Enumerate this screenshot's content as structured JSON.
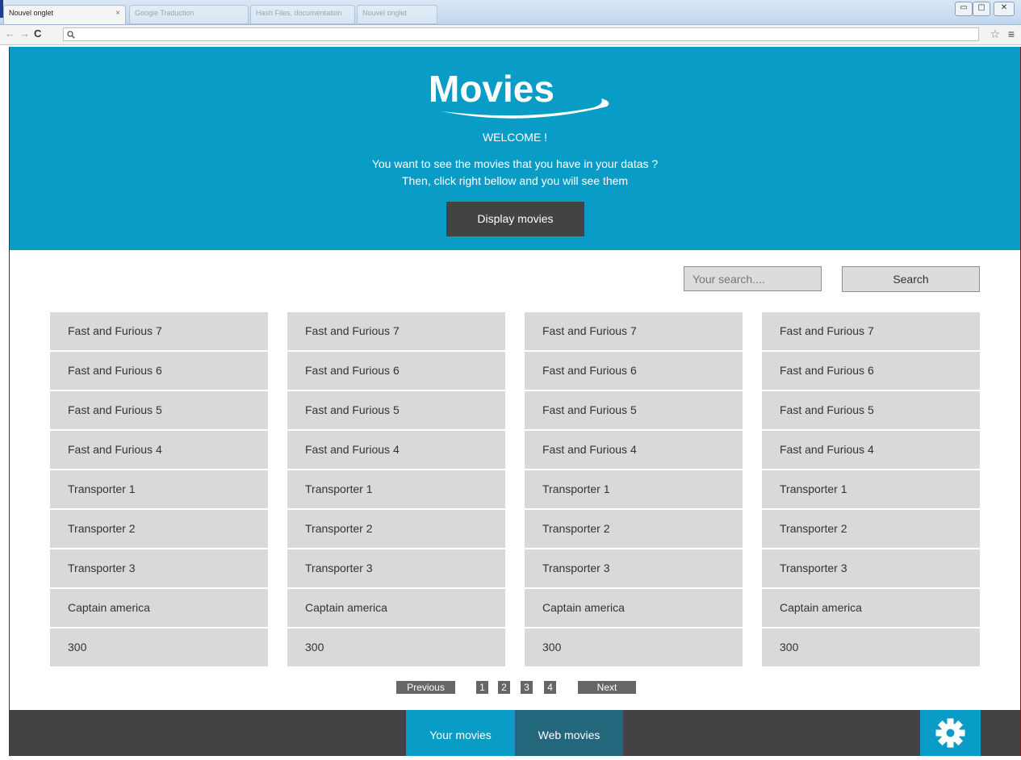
{
  "browser": {
    "active_tab": "Nouvel onglet",
    "tab_close": "×",
    "other_tabs": [
      "Google Traduction",
      "Hash Files, documentation",
      "Nouvel onglet"
    ],
    "window_controls": [
      "▭",
      "▢",
      "✕"
    ]
  },
  "addressbar": {
    "back": "←",
    "forward": "→",
    "reload": "C",
    "url": "",
    "star": "☆",
    "menu": "≡"
  },
  "hero": {
    "logo_text": "Movies",
    "welcome": "WELCOME !",
    "intro_line1": "You want to see the movies that you have in your datas ?",
    "intro_line2": "Then, click right bellow and you will see them",
    "display_button": "Display movies"
  },
  "search": {
    "placeholder": "Your search....",
    "button": "Search"
  },
  "movies": {
    "columns": [
      [
        "Fast and Furious 7",
        "Fast and Furious 6",
        "Fast and Furious 5",
        "Fast and Furious 4",
        "Transporter 1",
        "Transporter 2",
        "Transporter 3",
        "Captain america",
        "300"
      ],
      [
        "Fast and Furious 7",
        "Fast and Furious 6",
        "Fast and Furious 5",
        "Fast and Furious 4",
        "Transporter 1",
        "Transporter 2",
        "Transporter 3",
        "Captain america",
        "300"
      ],
      [
        "Fast and Furious 7",
        "Fast and Furious 6",
        "Fast and Furious 5",
        "Fast and Furious 4",
        "Transporter 1",
        "Transporter 2",
        "Transporter 3",
        "Captain america",
        "300"
      ],
      [
        "Fast and Furious 7",
        "Fast and Furious 6",
        "Fast and Furious 5",
        "Fast and Furious 4",
        "Transporter 1",
        "Transporter 2",
        "Transporter 3",
        "Captain america",
        "300"
      ]
    ]
  },
  "pagination": {
    "previous": "Previous",
    "pages": [
      "1",
      "2",
      "3",
      "4"
    ],
    "next": "Next"
  },
  "footer": {
    "tab_active": "Your movies",
    "tab_other": "Web movies",
    "settings_icon": "gear-icon"
  },
  "colors": {
    "accent": "#099cc6",
    "dark": "#434343",
    "tile": "#d9d9d9"
  }
}
